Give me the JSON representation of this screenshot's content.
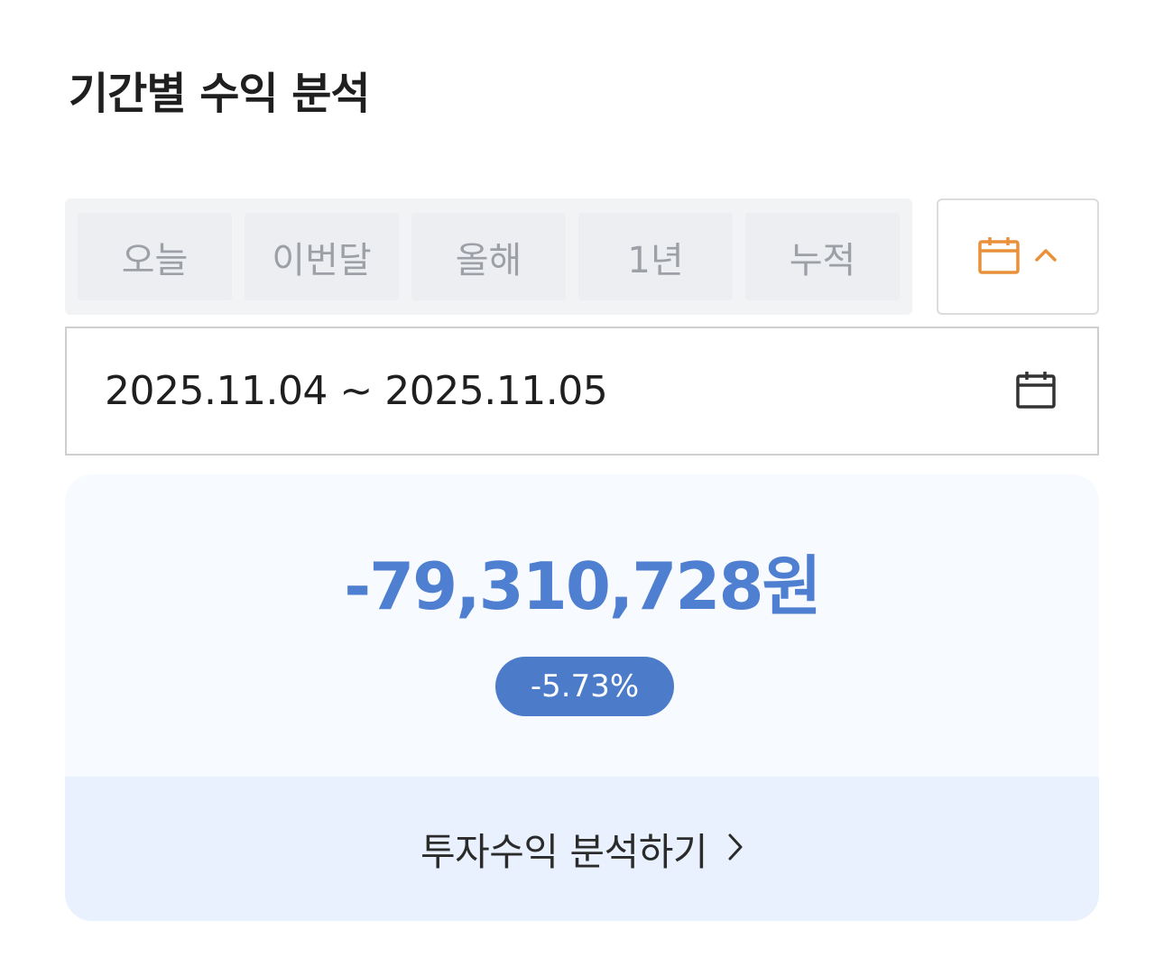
{
  "header": {
    "title": "기간별 수익 분석"
  },
  "period_tabs": [
    {
      "label": "오늘"
    },
    {
      "label": "이번달"
    },
    {
      "label": "올해"
    },
    {
      "label": "1년"
    },
    {
      "label": "누적"
    }
  ],
  "calendar_toggle": {
    "icon": "calendar-icon",
    "chevron": "chevron-up-icon",
    "accent_color": "#e8903a"
  },
  "date_range": {
    "text": "2025.11.04 ~ 2025.11.05",
    "icon": "calendar-icon"
  },
  "result": {
    "amount": "-79,310,728원",
    "rate": "-5.73%",
    "amount_color": "#4f7fd0",
    "badge_color": "#4c7cc9"
  },
  "analyze_link": {
    "label": "투자수익 분석하기",
    "icon": "chevron-right-icon"
  }
}
